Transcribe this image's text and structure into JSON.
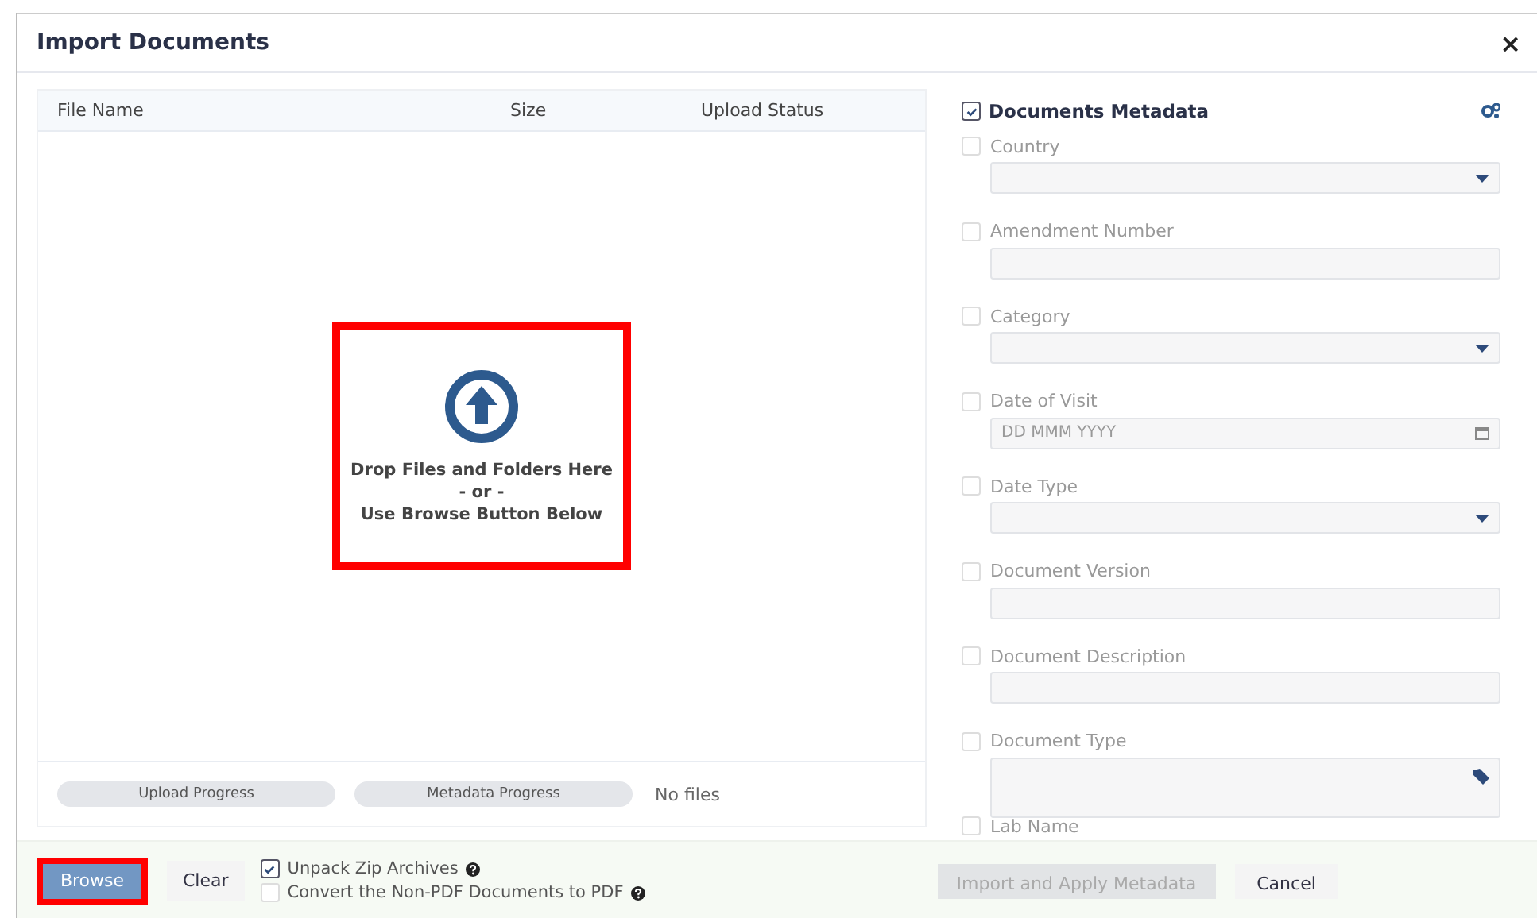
{
  "window": {
    "title": "Import Documents",
    "close": "×"
  },
  "file_table": {
    "columns": [
      "File Name",
      "Size",
      "Upload Status"
    ],
    "drop_zone": {
      "highlighted": true,
      "lines": [
        "Drop Files and Folders Here",
        "- or -",
        "Use Browse Button Below"
      ]
    },
    "progress": [
      {
        "label": "Upload Progress",
        "level": 0
      },
      {
        "label": "Metadata Progress",
        "level": 0
      }
    ],
    "status": "No files"
  },
  "metadata": {
    "title": "Documents Metadata",
    "checked": true,
    "fields": [
      {
        "label": "Country",
        "kind": "select",
        "checked": false
      },
      {
        "label": "Amendment Number",
        "kind": "text",
        "checked": false
      },
      {
        "label": "Category",
        "kind": "select",
        "checked": false
      },
      {
        "label": "Date of Visit",
        "kind": "date",
        "checked": false,
        "placeholder": "DD MMM YYYY"
      },
      {
        "label": "Date Type",
        "kind": "select",
        "checked": false
      },
      {
        "label": "Document Version",
        "kind": "text",
        "checked": false
      },
      {
        "label": "Document Description",
        "kind": "text",
        "checked": false
      },
      {
        "label": "Document Type",
        "kind": "tags",
        "checked": false
      },
      {
        "label": "Lab Name",
        "kind": "cut",
        "checked": false
      }
    ]
  },
  "footer": {
    "browse": {
      "label": "Browse",
      "highlighted": true
    },
    "clear": "Clear",
    "options": [
      {
        "label": "Unpack Zip Archives",
        "checked": true
      },
      {
        "label": "Convert the Non-PDF Documents to PDF",
        "checked": false
      }
    ],
    "import": {
      "label": "Import and Apply Metadata",
      "disabled": true
    },
    "cancel": "Cancel"
  }
}
